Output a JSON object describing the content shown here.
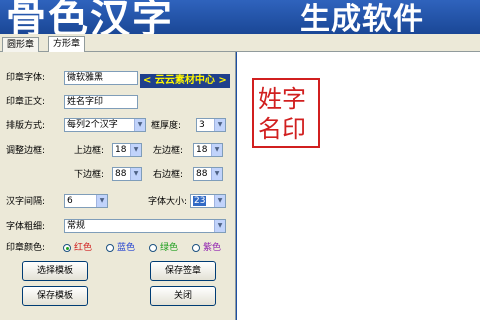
{
  "banner": {
    "left_text": "骨色汉字",
    "right_text": "生成软件"
  },
  "tabs": [
    {
      "label": "圆形章"
    },
    {
      "label": "方形章"
    }
  ],
  "form": {
    "font_label": "印章字体:",
    "font_value": "微软雅黑",
    "text_label": "印章正文:",
    "text_value": "姓名字印",
    "layout_label": "排版方式:",
    "layout_value": "每列2个汉字",
    "frame_thickness_label": "框厚度:",
    "frame_thickness_value": "3",
    "adjust_frame_label": "调整边框:",
    "top_label": "上边框:",
    "top_value": "18",
    "left_label": "左边框:",
    "left_value": "18",
    "bottom_label": "下边框:",
    "bottom_value": "88",
    "right_label": "右边框:",
    "right_value": "88",
    "spacing_label": "汉字间隔:",
    "spacing_value": "6",
    "size_label": "字体大小:",
    "size_value": "23",
    "weight_label": "字体粗细:",
    "weight_value": "常规",
    "color_label": "印章颜色:",
    "colors": [
      {
        "label": "红色",
        "color": "#d11f1f",
        "selected": true
      },
      {
        "label": "蓝色",
        "color": "#1f3fd1",
        "selected": false
      },
      {
        "label": "绿色",
        "color": "#1f9f1f",
        "selected": false
      },
      {
        "label": "紫色",
        "color": "#8f1fb0",
        "selected": false
      }
    ]
  },
  "buttons": {
    "choose_template": "选择模板",
    "save_seal": "保存签章",
    "save_template": "保存模板",
    "close": "关闭"
  },
  "watermark": "< 云云素材中心 >",
  "seal": {
    "row1": "姓字",
    "row2": "名印",
    "color": "#d11f1f"
  }
}
